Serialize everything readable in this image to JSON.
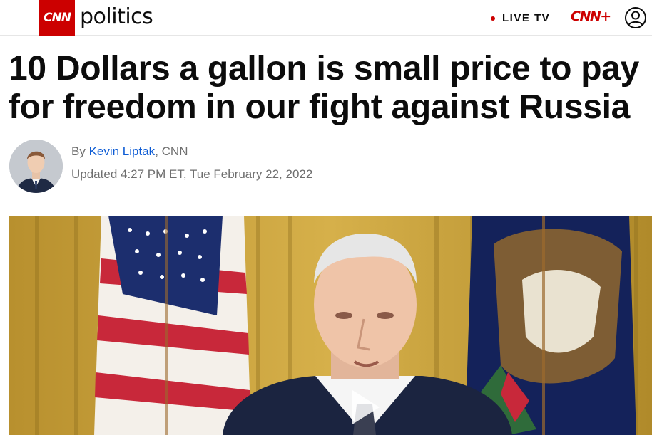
{
  "header": {
    "logo_text": "CNN",
    "section": "politics",
    "live_tv_label": "LIVE TV",
    "cnn_plus_label": "CNN+",
    "account_icon": "user-circle-icon",
    "accent_color": "#cc0000"
  },
  "article": {
    "headline": "10 Dollars a gallon is small price to pay for freedom in our fight against Russia",
    "byline_prefix": "By ",
    "author": "Kevin Liptak",
    "byline_suffix": ", CNN",
    "timestamp": "Updated 4:27 PM ET, Tue February 22, 2022",
    "link_color": "#0c5bd4"
  },
  "media": {
    "type": "video",
    "play_icon": "play-icon"
  }
}
